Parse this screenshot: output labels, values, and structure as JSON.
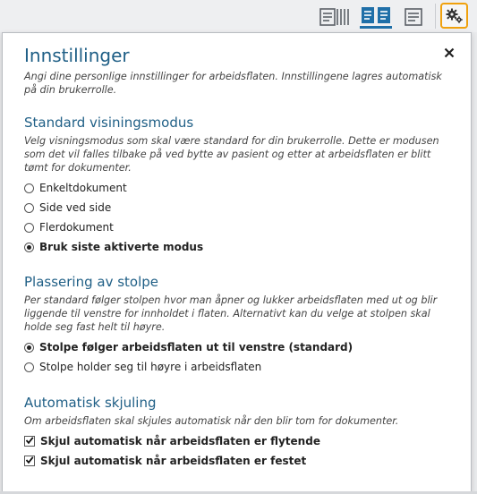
{
  "toolbar": {
    "multi_icon": "multi-document-view-icon",
    "side_icon": "side-by-side-view-icon",
    "single_icon": "single-document-view-icon",
    "settings_icon": "gear-icon",
    "accent": "#f0a10d",
    "active_color": "#1f6fa8"
  },
  "panel": {
    "title": "Innstillinger",
    "description": "Angi dine personlige innstillinger for arbeidsflaten. Innstillingene lagres automatisk på din brukerrolle.",
    "close_icon": "close-icon"
  },
  "view_mode": {
    "title": "Standard visiningsmodus",
    "description": "Velg visningsmodus som skal være standard for din brukerrolle. Dette er modusen som det vil falles tilbake på ved bytte av pasient og etter at arbeidsflaten er blitt tømt for dokumenter.",
    "options": [
      {
        "label": "Enkeltdokument",
        "selected": false
      },
      {
        "label": "Side ved side",
        "selected": false
      },
      {
        "label": "Flerdokument",
        "selected": false
      },
      {
        "label": "Bruk siste aktiverte modus",
        "selected": true
      }
    ]
  },
  "column_position": {
    "title": "Plassering av stolpe",
    "description": "Per standard følger stolpen hvor man åpner og lukker arbeidsflaten med ut og blir liggende til venstre for innholdet i flaten. Alternativt kan du velge at stolpen skal holde seg fast helt til høyre.",
    "options": [
      {
        "label": "Stolpe følger arbeidsflaten ut til venstre (standard)",
        "selected": true
      },
      {
        "label": "Stolpe holder seg til høyre i arbeidsflaten",
        "selected": false
      }
    ]
  },
  "auto_hide": {
    "title": "Automatisk skjuling",
    "description": "Om arbeidsflaten skal skjules automatisk når den blir tom for dokumenter.",
    "options": [
      {
        "label": "Skjul automatisk når arbeidsflaten er flytende",
        "checked": true
      },
      {
        "label": "Skjul automatisk når arbeidsflaten er festet",
        "checked": true
      }
    ]
  }
}
